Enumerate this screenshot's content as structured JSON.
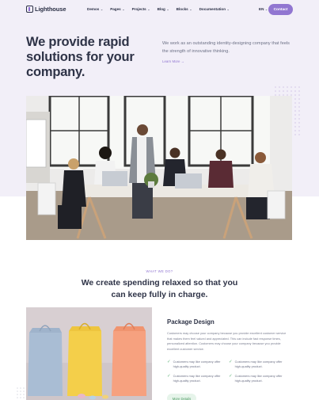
{
  "header": {
    "logo": "Lighthouse",
    "nav": [
      {
        "label": "Demos"
      },
      {
        "label": "Pages"
      },
      {
        "label": "Projects"
      },
      {
        "label": "Blog"
      },
      {
        "label": "Blocks"
      },
      {
        "label": "Documentation"
      }
    ],
    "lang": "EN",
    "contact": "Contact"
  },
  "hero": {
    "title": "We provide rapid solutions for your company.",
    "desc": "We work as an outstanding identity-designing company that feels the strength of innovative thinking.",
    "learn_more": "Learn More →"
  },
  "section": {
    "kicker": "WHAT WE DO?",
    "title": "We create spending relaxed so that you can keep fully in charge."
  },
  "package": {
    "title": "Package Design",
    "desc": "Customers may choose your company because you provide excellent customer service that makes them feel valued and appreciated. This can include fast response times, personalized attention. Customers may choose your company because you provide excellent customer service.",
    "features": [
      {
        "text": "Customers may like company offer high-quality product."
      },
      {
        "text": "Customers may like company offer high-quality product."
      },
      {
        "text": "Customers may like company offer high-quality product."
      },
      {
        "text": "Customers may like company offer high-quality product."
      }
    ],
    "more": "More Details"
  },
  "colors": {
    "accent": "#9176d1",
    "hero_bg": "#f2eff8",
    "check": "#62b37a"
  }
}
